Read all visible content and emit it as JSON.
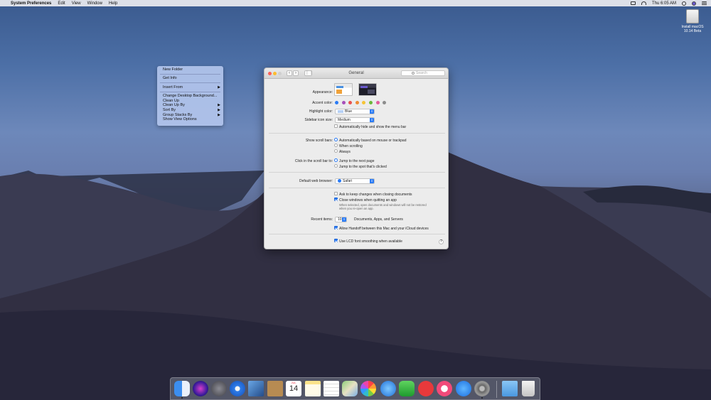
{
  "menubar": {
    "app_name": "System Preferences",
    "menus": [
      "Edit",
      "View",
      "Window",
      "Help"
    ],
    "clock": "Thu 6:05 AM",
    "status_icons": [
      "airplay-icon",
      "wifi-icon",
      "search-icon",
      "siri-icon",
      "notification-center-icon"
    ]
  },
  "desktop": {
    "disk_label_line1": "Install macOS",
    "disk_label_line2": "10.14 Beta"
  },
  "context_menu": {
    "items": [
      {
        "label": "New Folder"
      },
      {
        "label": "Get Info"
      },
      {
        "label": "Insert From"
      },
      {
        "label": "Change Desktop Background..."
      },
      {
        "label": "Clean Up"
      },
      {
        "label": "Clean Up By"
      },
      {
        "label": "Sort By"
      },
      {
        "label": "Group Stacks By"
      },
      {
        "label": "Show View Options"
      }
    ],
    "submenu_arrow": "▶"
  },
  "window": {
    "title": "General",
    "search_placeholder": "Search",
    "appearance_label": "Appearance:",
    "accent_label": "Accent color:",
    "accent_colors": [
      "#2a7bf5",
      "#a74fba",
      "#e8514f",
      "#ef8a32",
      "#f6c435",
      "#6bb83a",
      "#e45c9d",
      "#8c8c8c"
    ],
    "highlight_label": "Highlight color:",
    "highlight_value": "Blue",
    "sidebar_label": "Sidebar icon size:",
    "sidebar_value": "Medium",
    "menubar_autohide": "Automatically hide and show the menu bar",
    "scroll_label": "Show scroll bars:",
    "scroll_options": [
      "Automatically based on mouse or trackpad",
      "When scrolling",
      "Always"
    ],
    "click_label": "Click in the scroll bar to:",
    "click_options": [
      "Jump to the next page",
      "Jump to the spot that's clicked"
    ],
    "browser_label": "Default web browser:",
    "browser_value": "Safari",
    "ask_keep": "Ask to keep changes when closing documents",
    "close_windows": "Close windows when quitting an app",
    "close_windows_note1": "When selected, open documents and windows will not be restored",
    "close_windows_note2": "when you re-open an app.",
    "recent_label": "Recent items:",
    "recent_value": "10",
    "recent_suffix": "Documents, Apps, and Servers",
    "handoff": "Allow Handoff between this Mac and your iCloud devices",
    "lcd": "Use LCD font smoothing when available",
    "help": "?"
  },
  "dock": {
    "calendar_month": "JUL",
    "calendar_day": "14",
    "apps": [
      "finder-icon",
      "siri-icon",
      "launchpad-icon",
      "safari-icon",
      "photo-booth-icon",
      "contacts-icon",
      "calendar-icon",
      "notes-icon",
      "reminders-icon",
      "maps-icon",
      "photos-icon",
      "messages-icon",
      "facetime-icon",
      "news-icon",
      "music-icon",
      "app-store-icon",
      "system-preferences-icon",
      "downloads-folder-icon",
      "trash-icon"
    ]
  }
}
